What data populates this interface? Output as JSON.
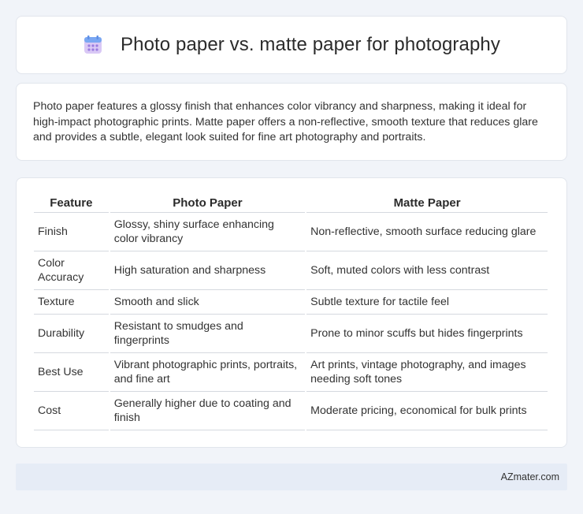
{
  "header": {
    "title": "Photo paper vs. matte paper for photography",
    "icon": "calendar-icon",
    "icon_colors": {
      "top": "#7aa7f2",
      "body": "#c9b2f0",
      "dots": "#9a7be0"
    }
  },
  "intro": {
    "text": "Photo paper features a glossy finish that enhances color vibrancy and sharpness, making it ideal for high-impact photographic prints. Matte paper offers a non-reflective, smooth texture that reduces glare and provides a subtle, elegant look suited for fine art photography and portraits."
  },
  "table": {
    "headers": [
      "Feature",
      "Photo Paper",
      "Matte Paper"
    ],
    "rows": [
      [
        "Finish",
        "Glossy, shiny surface enhancing color vibrancy",
        "Non-reflective, smooth surface reducing glare"
      ],
      [
        "Color Accuracy",
        "High saturation and sharpness",
        "Soft, muted colors with less contrast"
      ],
      [
        "Texture",
        "Smooth and slick",
        "Subtle texture for tactile feel"
      ],
      [
        "Durability",
        "Resistant to smudges and fingerprints",
        "Prone to minor scuffs but hides fingerprints"
      ],
      [
        "Best Use",
        "Vibrant photographic prints, portraits, and fine art",
        "Art prints, vintage photography, and images needing soft tones"
      ],
      [
        "Cost",
        "Generally higher due to coating and finish",
        "Moderate pricing, economical for bulk prints"
      ]
    ]
  },
  "footer": {
    "text": "AZmater.com"
  }
}
